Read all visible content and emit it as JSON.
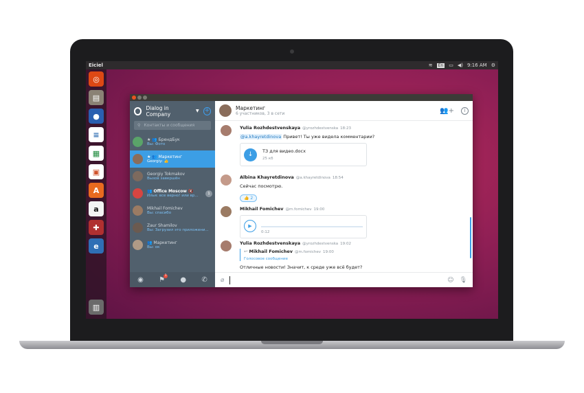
{
  "topbar": {
    "app_name": "Eiciel",
    "keyboard": "En",
    "time": "9:16 AM"
  },
  "launcher": {
    "items": [
      "ubuntu-icon",
      "files-icon",
      "firefox-icon",
      "writer-icon",
      "calc-icon",
      "impress-icon",
      "software-icon",
      "amazon-icon",
      "settings-icon",
      "eiciel-icon",
      "trash-icon"
    ]
  },
  "sidebar": {
    "title": "Dialog in Company",
    "search_placeholder": "Контакты и сообщения",
    "chats": [
      {
        "name": "★ 👥 БрендБук",
        "preview": "Вы: Фото",
        "active": false,
        "bold": false,
        "avatar_color": "#5aa469"
      },
      {
        "name": "★ 👥 Маркетинг",
        "preview": "Georgiy: 👍",
        "active": true,
        "bold": false,
        "avatar_color": "#8a6d5b"
      },
      {
        "name": "Georgiy Tokmakov",
        "preview": "Вызов завершён",
        "active": false,
        "bold": false,
        "avatar_color": "#7d6a5e"
      },
      {
        "name": "👥 Office Moscow 🔇",
        "preview": "Илья: все верно! или вр...",
        "active": false,
        "bold": true,
        "avatar_color": "#d64541",
        "unread": "1"
      },
      {
        "name": "Mikhail Fomichev",
        "preview": "Вы: спасибо",
        "active": false,
        "bold": false,
        "avatar_color": "#9b7b63"
      },
      {
        "name": "Zaur Shamilov",
        "preview": "Вы: Загрузил это приложени...",
        "active": false,
        "bold": false,
        "avatar_color": "#6b5a50"
      },
      {
        "name": "👥 Маркетинг",
        "preview": "Вы: ок",
        "active": false,
        "bold": false,
        "avatar_color": "#b09a86"
      }
    ],
    "bottom_icons": [
      "compass-icon",
      "chat-flag-icon",
      "contacts-icon",
      "phone-icon"
    ],
    "bottom_badge": "1"
  },
  "chat": {
    "title": "Маркетинг",
    "subtitle": "6 участников, 3 в сети",
    "messages": [
      {
        "author": "Yulia Rozhdestvenskaya",
        "handle": "@yrozhdestvenska",
        "time": "18:23",
        "mention": "@a.khayretdinova",
        "text": " Привет! Ты уже видела комментарии?",
        "file_name": "ТЗ для видео.docx",
        "file_size": "25 кб"
      },
      {
        "author": "Albina Khayretdinova",
        "handle": "@a.khayretdinova",
        "time": "18:54",
        "text": "Сейчас посмотрю.",
        "reaction": "👍 2"
      },
      {
        "author": "Mikhail Fomichev",
        "handle": "@m.fomichev",
        "time": "19:00",
        "audio_time": "0:12"
      },
      {
        "author": "Yulia Rozhdestvenskaya",
        "handle": "@yrozhdestvenska",
        "time": "19:02",
        "quote_author": "Mikhail Fomichev",
        "quote_handle": "@m.fomichev",
        "quote_time": "19:00",
        "quote_text": "Голосовое сообщение",
        "text": "Отличные новости! Значит, к среде уже всё будет?"
      }
    ]
  },
  "colors": {
    "accent": "#3c9ee5",
    "sidebar": "#51606d",
    "desktop": "#8f1f55"
  }
}
